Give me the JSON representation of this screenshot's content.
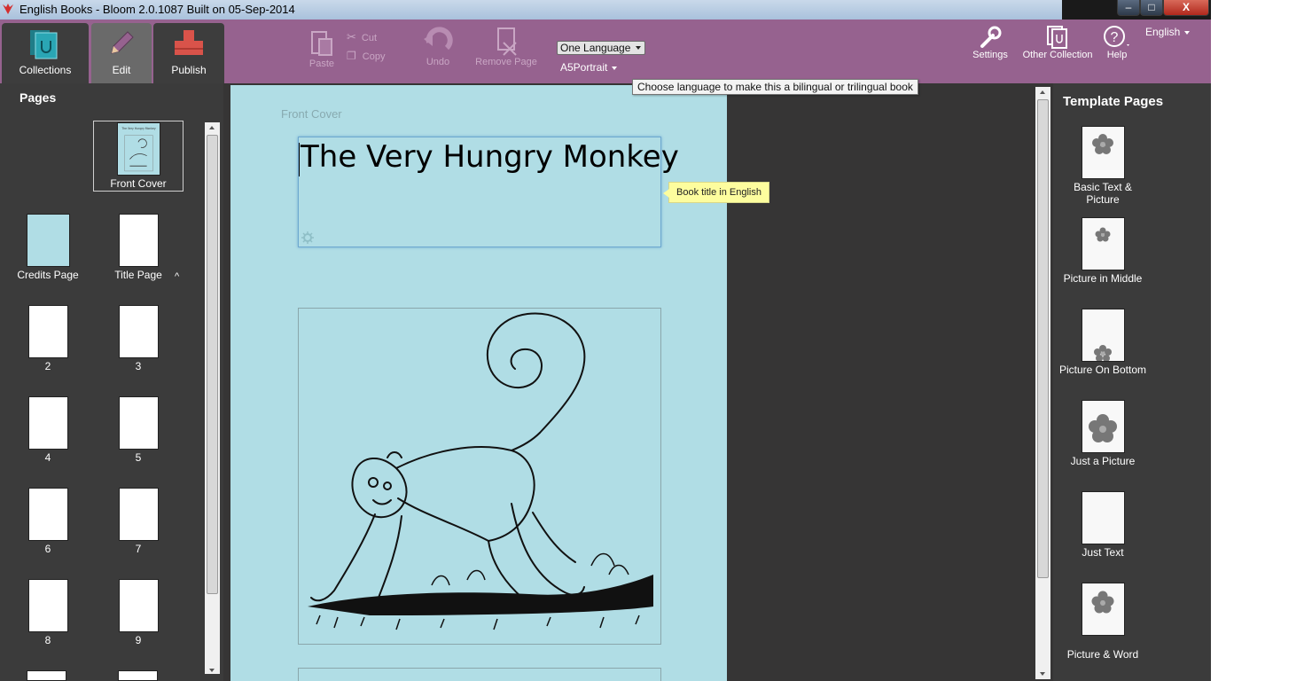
{
  "window": {
    "title": "English Books - Bloom 2.0.1087 Built on 05-Sep-2014",
    "minimize": "–",
    "maximize": "□",
    "close": "X"
  },
  "tabs": {
    "collections": "Collections",
    "edit": "Edit",
    "publish": "Publish"
  },
  "toolbar": {
    "paste": "Paste",
    "cut": "Cut",
    "copy": "Copy",
    "undo": "Undo",
    "remove_page": "Remove Page",
    "language_select": "One Language",
    "layout_select": "A5Portrait",
    "settings": "Settings",
    "other_collection": "Other Collection",
    "help": "Help",
    "ui_language": "English"
  },
  "tooltip": "Choose language to make this a bilingual or trilingual book",
  "pages_pane": {
    "title": "Pages",
    "pages": [
      {
        "label": "Front Cover"
      },
      {
        "label": "Credits Page"
      },
      {
        "label": "Title Page"
      },
      {
        "label": "2"
      },
      {
        "label": "3"
      },
      {
        "label": "4"
      },
      {
        "label": "5"
      },
      {
        "label": "6"
      },
      {
        "label": "7"
      },
      {
        "label": "8"
      },
      {
        "label": "9"
      }
    ],
    "cover_thumb_text": "The Very Hungry Monkey"
  },
  "editor": {
    "page_label": "Front Cover",
    "book_title": "The Very Hungry Monkey",
    "bubble": "Book title in English"
  },
  "template_pane": {
    "title": "Template Pages",
    "items": [
      {
        "label": "Basic Text & Picture"
      },
      {
        "label": "Picture in Middle"
      },
      {
        "label": "Picture On Bottom"
      },
      {
        "label": "Just a Picture"
      },
      {
        "label": "Just Text"
      },
      {
        "label": "Picture & Word"
      }
    ]
  },
  "colors": {
    "toolbar": "#96628f",
    "page": "#b0dde5",
    "accent_publish": "#d9534a",
    "accent_collections": "#2aa6b4"
  }
}
